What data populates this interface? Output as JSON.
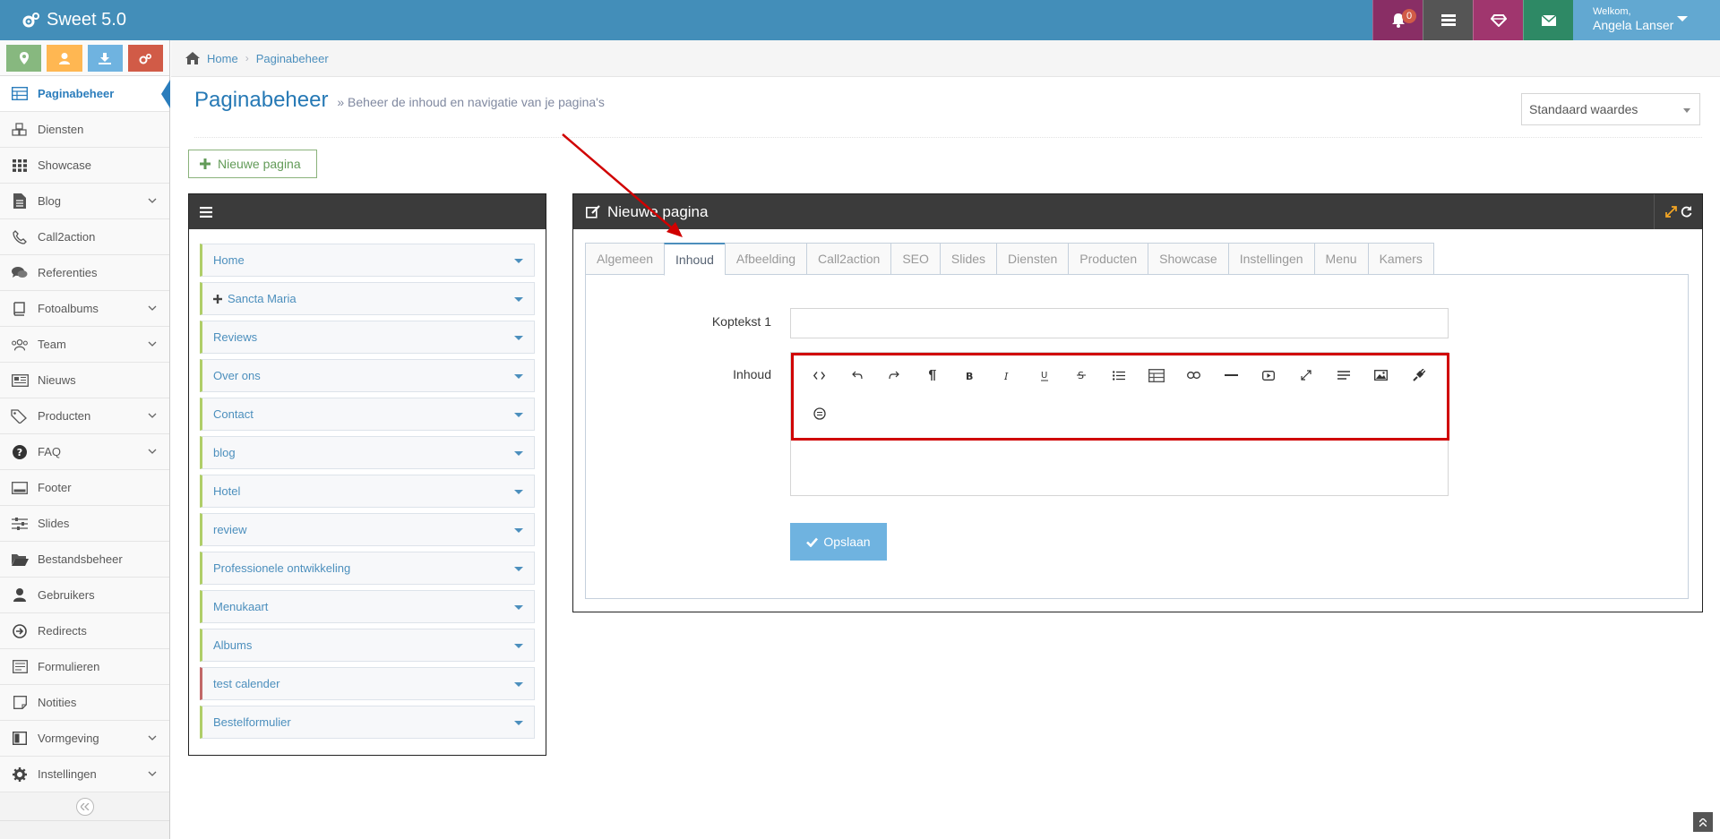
{
  "app": {
    "brand": "Sweet 5.0"
  },
  "topbar": {
    "notification_count": "0",
    "welcome": "Welkom,",
    "user_name": "Angela Lanser"
  },
  "sidebar": {
    "shortcut_colors": [
      "#87b87f",
      "#ffb752",
      "#6fb3e0",
      "#d15b47"
    ],
    "items": [
      {
        "label": "Paginabeheer",
        "icon": "table-icon",
        "active": true,
        "has_children": false
      },
      {
        "label": "Diensten",
        "icon": "cubes-icon",
        "has_children": false
      },
      {
        "label": "Showcase",
        "icon": "grid-icon",
        "has_children": false
      },
      {
        "label": "Blog",
        "icon": "file-icon",
        "has_children": true
      },
      {
        "label": "Call2action",
        "icon": "phone-icon",
        "has_children": false
      },
      {
        "label": "Referenties",
        "icon": "comments-icon",
        "has_children": false
      },
      {
        "label": "Fotoalbums",
        "icon": "book-icon",
        "has_children": true
      },
      {
        "label": "Team",
        "icon": "users-icon",
        "has_children": true
      },
      {
        "label": "Nieuws",
        "icon": "newspaper-icon",
        "has_children": false
      },
      {
        "label": "Producten",
        "icon": "tags-icon",
        "has_children": true
      },
      {
        "label": "FAQ",
        "icon": "question-icon",
        "has_children": true
      },
      {
        "label": "Footer",
        "icon": "footer-icon",
        "has_children": false
      },
      {
        "label": "Slides",
        "icon": "sliders-icon",
        "has_children": false
      },
      {
        "label": "Bestandsbeheer",
        "icon": "folder-icon",
        "has_children": false
      },
      {
        "label": "Gebruikers",
        "icon": "user-icon",
        "has_children": false
      },
      {
        "label": "Redirects",
        "icon": "redirect-icon",
        "has_children": false
      },
      {
        "label": "Formulieren",
        "icon": "form-icon",
        "has_children": false
      },
      {
        "label": "Notities",
        "icon": "note-icon",
        "has_children": false
      },
      {
        "label": "Vormgeving",
        "icon": "layout-icon",
        "has_children": true
      },
      {
        "label": "Instellingen",
        "icon": "gear-icon",
        "has_children": true
      }
    ]
  },
  "breadcrumb": {
    "home": "Home",
    "current": "Paginabeheer"
  },
  "header": {
    "title": "Paginabeheer",
    "subtitle": "» Beheer de inhoud en navigatie van je pagina's",
    "dropdown_value": "Standaard waardes"
  },
  "new_page_button": "Nieuwe pagina",
  "page_list": [
    {
      "label": "Home",
      "expandable": false
    },
    {
      "label": "Sancta Maria",
      "expandable": true
    },
    {
      "label": "Reviews",
      "expandable": false
    },
    {
      "label": "Over ons",
      "expandable": false
    },
    {
      "label": "Contact",
      "expandable": false
    },
    {
      "label": "blog",
      "expandable": false
    },
    {
      "label": "Hotel",
      "expandable": false
    },
    {
      "label": "review",
      "expandable": false
    },
    {
      "label": "Professionele ontwikkeling",
      "expandable": false
    },
    {
      "label": "Menukaart",
      "expandable": false
    },
    {
      "label": "Albums",
      "expandable": false
    },
    {
      "label": "test calender",
      "expandable": false,
      "status": "red"
    },
    {
      "label": "Bestelformulier",
      "expandable": false
    }
  ],
  "editor_panel": {
    "title": "Nieuwe pagina",
    "tabs": [
      "Algemeen",
      "Inhoud",
      "Afbeelding",
      "Call2action",
      "SEO",
      "Slides",
      "Diensten",
      "Producten",
      "Showcase",
      "Instellingen",
      "Menu",
      "Kamers"
    ],
    "active_tab": "Inhoud",
    "field_koptekst_label": "Koptekst 1",
    "field_koptekst_value": "",
    "field_inhoud_label": "Inhoud",
    "toolbar_row1": [
      "code-icon",
      "undo-icon",
      "redo-icon",
      "paragraph-icon",
      "bold-icon",
      "italic-icon",
      "underline-icon",
      "strikethrough-icon",
      "list-icon",
      "table-icon",
      "link-icon",
      "horizontal-rule-icon",
      "video-icon",
      "fullscreen-icon",
      "align-icon",
      "image-icon",
      "plugin-icon"
    ],
    "toolbar_row2": [
      "emoji-icon"
    ],
    "save_label": "Opslaan"
  }
}
